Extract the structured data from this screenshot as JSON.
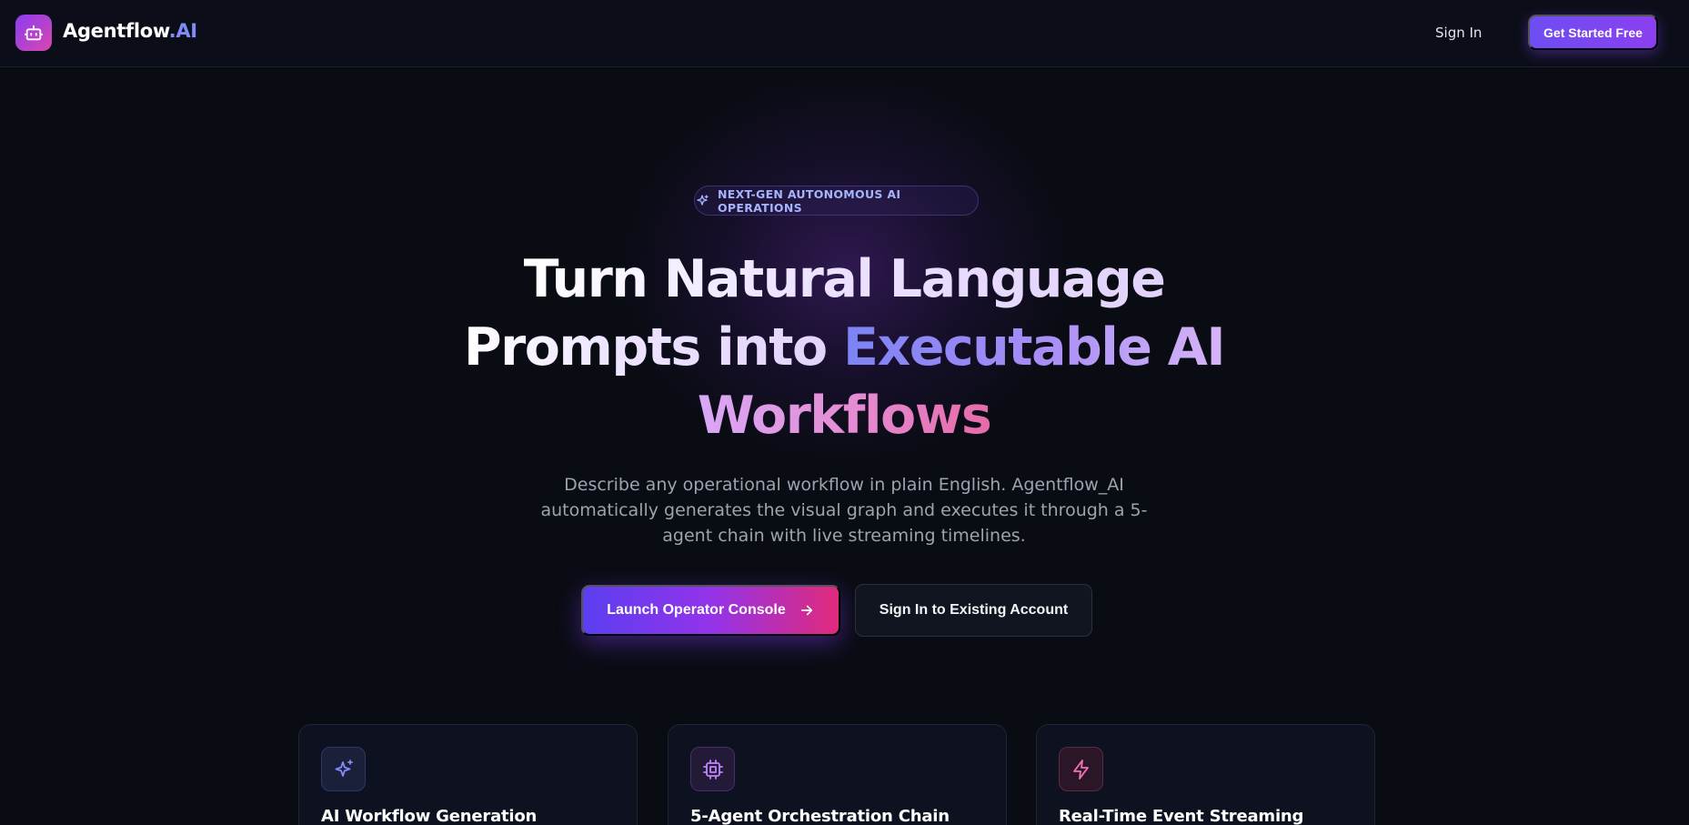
{
  "nav": {
    "brand_main": "Agentflow",
    "brand_accent": ".AI",
    "logo_icon": "bot-icon",
    "sign_in": "Sign In",
    "get_started": "Get Started Free"
  },
  "hero": {
    "badge_icon": "sparkles-icon",
    "badge": "NEXT-GEN AUTONOMOUS AI OPERATIONS",
    "headline_line1": "Turn Natural Language",
    "headline_line2_plain": "Prompts into ",
    "headline_line2_accent": "Executable AI",
    "headline_line3_accent": "Workflows",
    "description": "Describe any operational workflow in plain English. Agentflow_AI automatically generates the visual graph and executes it through a 5-agent chain with live streaming timelines.",
    "primary_button": "Launch Operator Console",
    "primary_button_icon": "arrow-right-icon",
    "secondary_button": "Sign In to Existing Account"
  },
  "features": [
    {
      "icon": "sparkles-icon",
      "title": "AI Workflow Generation",
      "color": "#818cf8"
    },
    {
      "icon": "cpu-icon",
      "title": "5-Agent Orchestration Chain",
      "color": "#c084fc"
    },
    {
      "icon": "zap-icon",
      "title": "Real-Time Event Streaming",
      "color": "#f472b6"
    }
  ],
  "colors": {
    "background": "#0a0c14",
    "accent_indigo": "#818cf8",
    "accent_purple": "#8b3cf0",
    "accent_pink": "#e12a7a"
  }
}
